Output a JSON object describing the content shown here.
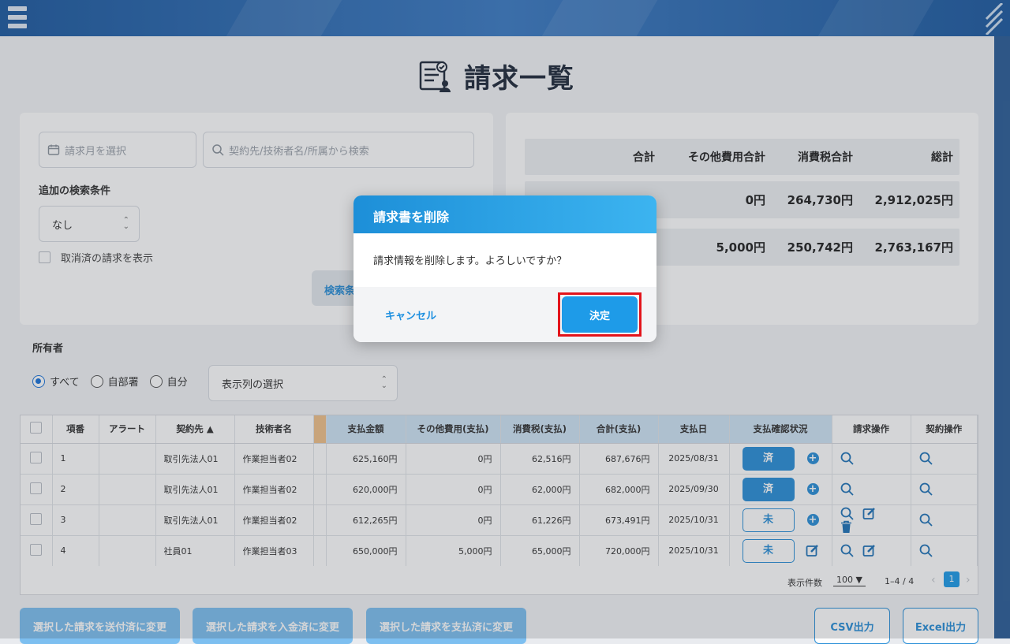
{
  "page": {
    "title": "請求一覧"
  },
  "search": {
    "month_placeholder": "請求月を選択",
    "keyword_placeholder": "契約先/技術者名/所属から検索",
    "extra_label": "追加の検索条件",
    "extra_value": "なし",
    "show_cancelled_label": "取消済の請求を表示",
    "search_button": "検索条"
  },
  "summary": {
    "headers": [
      "合計",
      "その他費用合計",
      "消費税合計",
      "総計"
    ],
    "rows": [
      [
        "",
        "0円",
        "264,730円",
        "2,912,025円"
      ],
      [
        "",
        "5,000円",
        "250,742円",
        "2,763,167円"
      ]
    ]
  },
  "owner": {
    "label": "所有者",
    "options": [
      "すべて",
      "自部署",
      "自分"
    ],
    "selected": "すべて",
    "columns_select": "表示列の選択"
  },
  "table": {
    "headers": [
      "項番",
      "アラート",
      "契約先 ▲",
      "技術者名",
      "支払金額",
      "その他費用(支払)",
      "消費税(支払)",
      "合計(支払)",
      "支払日",
      "支払確認状況",
      "請求操作",
      "契約操作"
    ],
    "rows": [
      {
        "no": "1",
        "alert": "",
        "client": "取引先法人01",
        "engineer": "作業担当者02",
        "pay": "625,160円",
        "other": "0円",
        "tax": "62,516円",
        "total": "687,676円",
        "date": "2025/08/31",
        "status": "済"
      },
      {
        "no": "2",
        "alert": "",
        "client": "取引先法人01",
        "engineer": "作業担当者02",
        "pay": "620,000円",
        "other": "0円",
        "tax": "62,000円",
        "total": "682,000円",
        "date": "2025/09/30",
        "status": "済"
      },
      {
        "no": "3",
        "alert": "",
        "client": "取引先法人01",
        "engineer": "作業担当者02",
        "pay": "612,265円",
        "other": "0円",
        "tax": "61,226円",
        "total": "673,491円",
        "date": "2025/10/31",
        "status": "未"
      },
      {
        "no": "4",
        "alert": "",
        "client": "社員01",
        "engineer": "作業担当者03",
        "pay": "650,000円",
        "other": "5,000円",
        "tax": "65,000円",
        "total": "720,000円",
        "date": "2025/10/31",
        "status": "未"
      }
    ]
  },
  "pagination": {
    "per_page_label": "表示件数",
    "per_page": "100",
    "range": "1–4 / 4",
    "page": "1"
  },
  "bottom": {
    "btn_sent": "選択した請求を送付済に変更",
    "btn_received": "選択した請求を入金済に変更",
    "btn_paid": "選択した請求を支払済に変更",
    "btn_csv": "CSV出力",
    "btn_excel": "Excel出力"
  },
  "modal": {
    "title": "請求書を削除",
    "message": "請求情報を削除します。よろしいですか？",
    "cancel": "キャンセル",
    "ok": "決定"
  },
  "colors": {
    "accent": "#2a8fd8",
    "highlight": "#e3141b",
    "banner": "#1d5aa0"
  }
}
